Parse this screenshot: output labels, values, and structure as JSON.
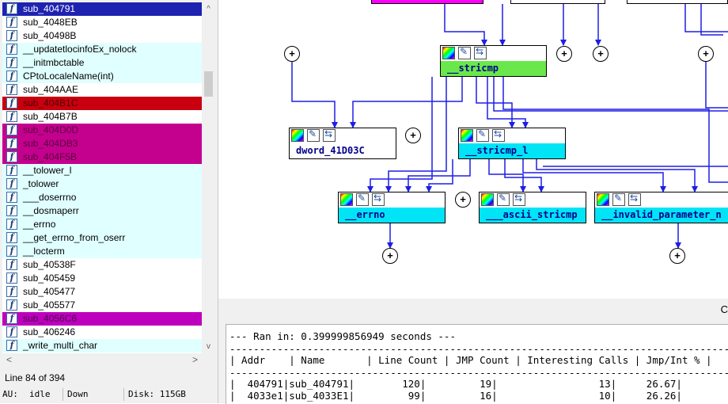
{
  "functions": [
    {
      "name": "sub_404791",
      "highlight": "#1e22b0",
      "text_color": "#ffffff"
    },
    {
      "name": "sub_4048EB",
      "highlight": "#ffffff",
      "text_color": "#000000"
    },
    {
      "name": "sub_40498B",
      "highlight": "#ffffff",
      "text_color": "#000000"
    },
    {
      "name": "__updatetlocinfoEx_nolock",
      "highlight": "#e0ffff",
      "text_color": "#000000"
    },
    {
      "name": "__initmbctable",
      "highlight": "#e0ffff",
      "text_color": "#000000"
    },
    {
      "name": "CPtoLocaleName(int)",
      "highlight": "#e0ffff",
      "text_color": "#000000"
    },
    {
      "name": "sub_404AAE",
      "highlight": "#ffffff",
      "text_color": "#000000"
    },
    {
      "name": "sub_404B1C",
      "highlight": "#c8000f",
      "text_color": "#500000"
    },
    {
      "name": "sub_404B7B",
      "highlight": "#ffffff",
      "text_color": "#000000"
    },
    {
      "name": "sub_404D0D",
      "highlight": "#c4008e",
      "text_color": "#5a0040"
    },
    {
      "name": "sub_404DB3",
      "highlight": "#c4008e",
      "text_color": "#5a0040"
    },
    {
      "name": "sub_404F5B",
      "highlight": "#c4008e",
      "text_color": "#5a0040"
    },
    {
      "name": "__tolower_l",
      "highlight": "#e0ffff",
      "text_color": "#000000"
    },
    {
      "name": "_tolower",
      "highlight": "#e0ffff",
      "text_color": "#000000"
    },
    {
      "name": "___doserrno",
      "highlight": "#e0ffff",
      "text_color": "#000000"
    },
    {
      "name": "__dosmaperr",
      "highlight": "#e0ffff",
      "text_color": "#000000"
    },
    {
      "name": "__errno",
      "highlight": "#e0ffff",
      "text_color": "#000000"
    },
    {
      "name": "__get_errno_from_oserr",
      "highlight": "#e0ffff",
      "text_color": "#000000"
    },
    {
      "name": "__locterm",
      "highlight": "#e0ffff",
      "text_color": "#000000"
    },
    {
      "name": "sub_40538F",
      "highlight": "#ffffff",
      "text_color": "#000000"
    },
    {
      "name": "sub_405459",
      "highlight": "#ffffff",
      "text_color": "#000000"
    },
    {
      "name": "sub_405477",
      "highlight": "#ffffff",
      "text_color": "#000000"
    },
    {
      "name": "sub_405577",
      "highlight": "#ffffff",
      "text_color": "#000000"
    },
    {
      "name": "sub_4056C6",
      "highlight": "#bd00bd",
      "text_color": "#500050"
    },
    {
      "name": "sub_406246",
      "highlight": "#ffffff",
      "text_color": "#000000"
    },
    {
      "name": "_write_multi_char",
      "highlight": "#e0ffff",
      "text_color": "#000000"
    }
  ],
  "function_icon_glyph": "f",
  "scroll": {
    "up": "^",
    "down": "v",
    "left": "<",
    "right": ">"
  },
  "line_info": "Line 84 of 394",
  "status": {
    "au_label": "AU:",
    "au_value": "idle",
    "direction": "Down",
    "disk": "Disk: 115GB"
  },
  "graph": {
    "nodes": [
      {
        "id": "stricmp",
        "label": "__stricmp",
        "color": "#6ae84b"
      },
      {
        "id": "dword",
        "label": "dword_41D03C",
        "color": "#ffffff"
      },
      {
        "id": "stricmp_l",
        "label": "__stricmp_l",
        "color": "#00e4f6"
      },
      {
        "id": "errno",
        "label": "__errno",
        "color": "#00e4f6"
      },
      {
        "id": "ascii",
        "label": "___ascii_stricmp",
        "color": "#00e4f6"
      },
      {
        "id": "invalid",
        "label": "__invalid_parameter_n",
        "color": "#00e4f6"
      }
    ],
    "plus_glyph": "+",
    "edge_color": "#1e1ee6"
  },
  "pane_control": "C",
  "output": {
    "ran_line": "--- Ran in: 0.399999856949 seconds ---",
    "divider": "------------------------------------------------------------------------------------",
    "headers": [
      "Addr",
      "Name",
      "Line Count",
      "JMP Count",
      "Interesting Calls",
      "Jmp/Int %"
    ],
    "rows": [
      [
        "404791",
        "sub_404791",
        "120",
        "19",
        "13",
        "26.67"
      ],
      [
        "4033e1",
        "sub_4033E1",
        "99",
        "16",
        "10",
        "26.26"
      ]
    ],
    "header_line": "| Addr    | Name       | Line Count | JMP Count | Interesting Calls | Jmp/Int % |",
    "row_lines": [
      "|  404791|sub_404791|        120|         19|                 13|     26.67|",
      "|  4033e1|sub_4033E1|         99|         16|                 10|     26.26|"
    ]
  }
}
